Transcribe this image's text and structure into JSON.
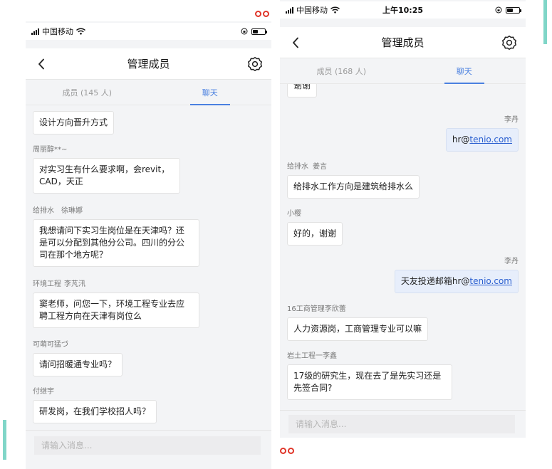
{
  "left": {
    "status": {
      "carrier": "中国移动"
    },
    "nav": {
      "title": "管理成员"
    },
    "tabs": [
      {
        "label": "成员 (145 人)"
      },
      {
        "label": "聊天"
      }
    ],
    "messages": [
      {
        "sender": "",
        "text": "设计方向晋升方式"
      },
      {
        "sender": "周丽醇**~",
        "text": "对实习生有什么要求啊，会revit，\nCAD，天正"
      },
      {
        "dept": "给排水",
        "sender": "徐琳娜",
        "text": "我想请问下实习生岗位是在天津吗？还\n是可以分配到其他分公司。四川的分公\n司在那个地方呢？"
      },
      {
        "dept": "环境工程",
        "sender": "李芃汛",
        "text": "窦老师，问您一下，环境工程专业去应\n聘工程方向在天津有岗位么"
      },
      {
        "sender": "可萌可猛づ",
        "text": "请问招暖通专业吗？"
      },
      {
        "sender": "付继宇",
        "text": "研发岗，在我们学校招人吗？"
      }
    ],
    "input": {
      "placeholder": "请输入消息..."
    }
  },
  "right": {
    "status": {
      "carrier": "中国移动",
      "time": "上午10:25"
    },
    "nav": {
      "title": "管理成员"
    },
    "tabs": [
      {
        "label": "成员 (168 人)"
      },
      {
        "label": "聊天"
      }
    ],
    "messages": [
      {
        "text": "谢谢"
      },
      {
        "sender": "李丹",
        "prefix": "hr@",
        "link": "tenio.com"
      },
      {
        "dept": "给排水",
        "sender": "姜言",
        "text": "给排水工作方向是建筑给排水么"
      },
      {
        "sender": "小樱",
        "text": "好的，谢谢"
      },
      {
        "sender": "李丹",
        "prefix": "天友投递邮箱hr@",
        "link": "tenio.com"
      },
      {
        "sender": "16工商管理李欣蕾",
        "text": "人力资源岗，工商管理专业可以嘛"
      },
      {
        "sender": "岩土工程一李鑫",
        "text": "17级的研究生，现在去了是先实习还是\n先签合同?"
      }
    ],
    "input": {
      "placeholder": "请输入消息..."
    }
  },
  "icons": {
    "back": "chevron-left-icon",
    "settings": "gear-icon",
    "signal": "signal-bars-icon",
    "wifi": "wifi-icon",
    "lock": "orientation-lock-icon",
    "battery": "battery-icon"
  },
  "colors": {
    "accent": "#4a80e0",
    "link": "#2a5fd0",
    "mine_bubble": "#e7eefb",
    "marker": "#e0362a",
    "edge": "#80d6c8"
  }
}
